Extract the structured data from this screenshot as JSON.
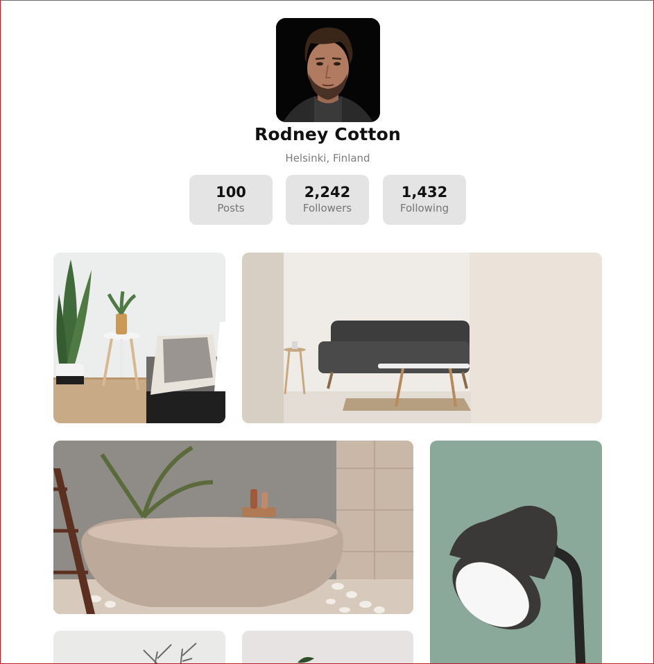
{
  "profile": {
    "name": "Rodney Cotton",
    "location": "Helsinki, Finland"
  },
  "stats": [
    {
      "value": "100",
      "label": "Posts"
    },
    {
      "value": "2,242",
      "label": "Followers"
    },
    {
      "value": "1,432",
      "label": "Following"
    }
  ],
  "gallery": [
    {
      "subject": "living-room-plant"
    },
    {
      "subject": "dark-sofa"
    },
    {
      "subject": "bathtub"
    },
    {
      "subject": "desk-lamp"
    },
    {
      "subject": "branches"
    },
    {
      "subject": "plant"
    }
  ]
}
